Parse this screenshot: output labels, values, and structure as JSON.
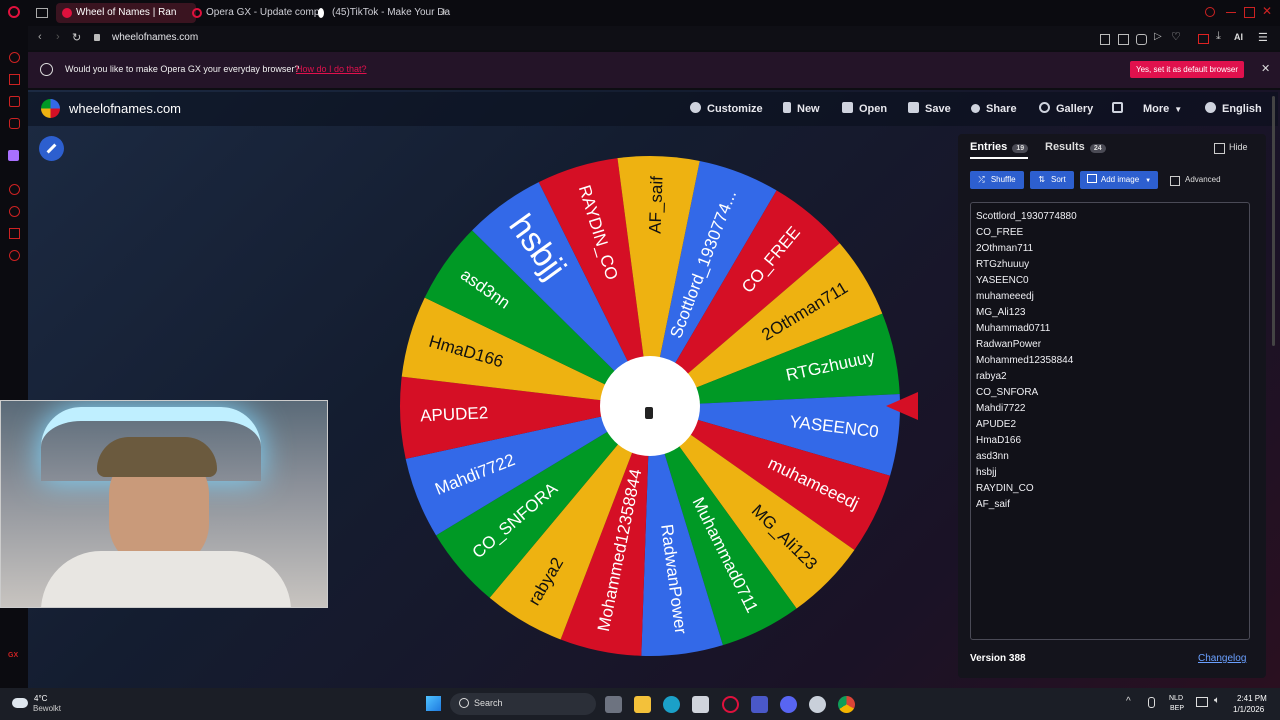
{
  "browser": {
    "tabs": [
      {
        "title": "Wheel of Names | Ran"
      },
      {
        "title": "Opera GX - Update comp"
      },
      {
        "title": "(45)TikTok - Make Your Da"
      }
    ],
    "new_tab": "+",
    "url": "wheelofnames.com"
  },
  "infobar": {
    "message": "Would you like to make Opera GX your everyday browser?",
    "link": "How do I do that?",
    "cta": "Yes, set it as default browser",
    "close": "✕"
  },
  "header": {
    "logo": "wheelofnames.com",
    "nav": [
      "Customize",
      "New",
      "Open",
      "Save",
      "Share",
      "Gallery",
      "",
      "More",
      "English"
    ]
  },
  "wheel": {
    "segments": [
      "Scottlord_1930774...",
      "CO_FREE",
      "2Othman711",
      "RTGzhuuuy",
      "YASEENC0",
      "muhameeedj",
      "MG_Ali123",
      "Muhammad0711",
      "RadwanPower",
      "Mohammed12358844",
      "rabya2",
      "CO_SNFORA",
      "Mahdi7722",
      "APUDE2",
      "HmaD166",
      "asd3nn",
      "hsbjj",
      "RAYDIN_CO",
      "AF_saif"
    ],
    "colors": [
      "#3369e8",
      "#d50f25",
      "#eeb211",
      "#009925"
    ]
  },
  "panel": {
    "tab_entries": "Entries",
    "entries_count": "19",
    "tab_results": "Results",
    "results_count": "24",
    "hide_label": "Hide",
    "shuffle": "Shuffle",
    "sort": "Sort",
    "add_image": "Add image",
    "advanced": "Advanced",
    "entries": [
      "Scottlord_1930774880",
      "CO_FREE",
      "2Othman711",
      "RTGzhuuuy",
      "YASEENC0",
      "muhameeedj",
      "MG_Ali123",
      "Muhammad0711",
      "RadwanPower",
      "Mohammed12358844",
      "rabya2",
      "CO_SNFORA",
      "Mahdi7722",
      "APUDE2",
      "HmaD166",
      "asd3nn",
      "hsbjj",
      "RAYDIN_CO",
      "AF_saif"
    ],
    "version": "Version 388",
    "changelog": "Changelog"
  },
  "taskbar": {
    "weather_temp": "4°C",
    "weather_desc": "Bewolkt",
    "search": "Search",
    "lang_top": "NLD",
    "lang_bottom": "BEP",
    "time": "2:41 PM",
    "date": "1/1/2026"
  }
}
